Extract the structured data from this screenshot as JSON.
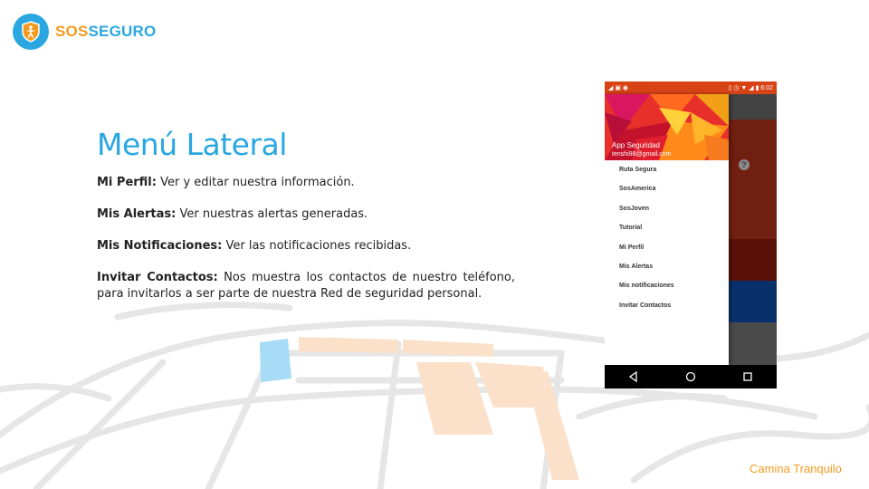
{
  "brand": {
    "name_part1": "SOS",
    "name_part2": "SEGURO",
    "logo_icon": "shield-walker-icon",
    "primary_color": "#2aa7e0",
    "accent_color": "#f39a1f"
  },
  "slide": {
    "title": "Menú Lateral",
    "items": [
      {
        "term": "Mi Perfil:",
        "desc": " Ver y editar nuestra información."
      },
      {
        "term": "Mis Alertas:",
        "desc": " Ver nuestras alertas generadas."
      },
      {
        "term": "Mis Notificaciones:",
        "desc": " Ver las notificaciones recibidas."
      },
      {
        "term": "Invitar Contactos:",
        "desc": " Nos muestra los contactos de nuestro teléfono, para invitarlos a ser parte de nuestra Red de seguridad personal."
      }
    ],
    "tagline": "Camina Tranquilo"
  },
  "phone": {
    "status_time": "6:02",
    "drawer": {
      "account_name": "App Seguridad",
      "account_email": "tenshi98@gmail.com",
      "menu": [
        "Ruta Segura",
        "SosAmerica",
        "SosJoven",
        "Tutorial",
        "Mi Perfil",
        "Mis Alertas",
        "Mis notificaciones",
        "Invitar Contactos"
      ]
    },
    "help_icon_text": "?",
    "nav_icons": [
      "back-icon",
      "home-icon",
      "recents-icon"
    ]
  }
}
